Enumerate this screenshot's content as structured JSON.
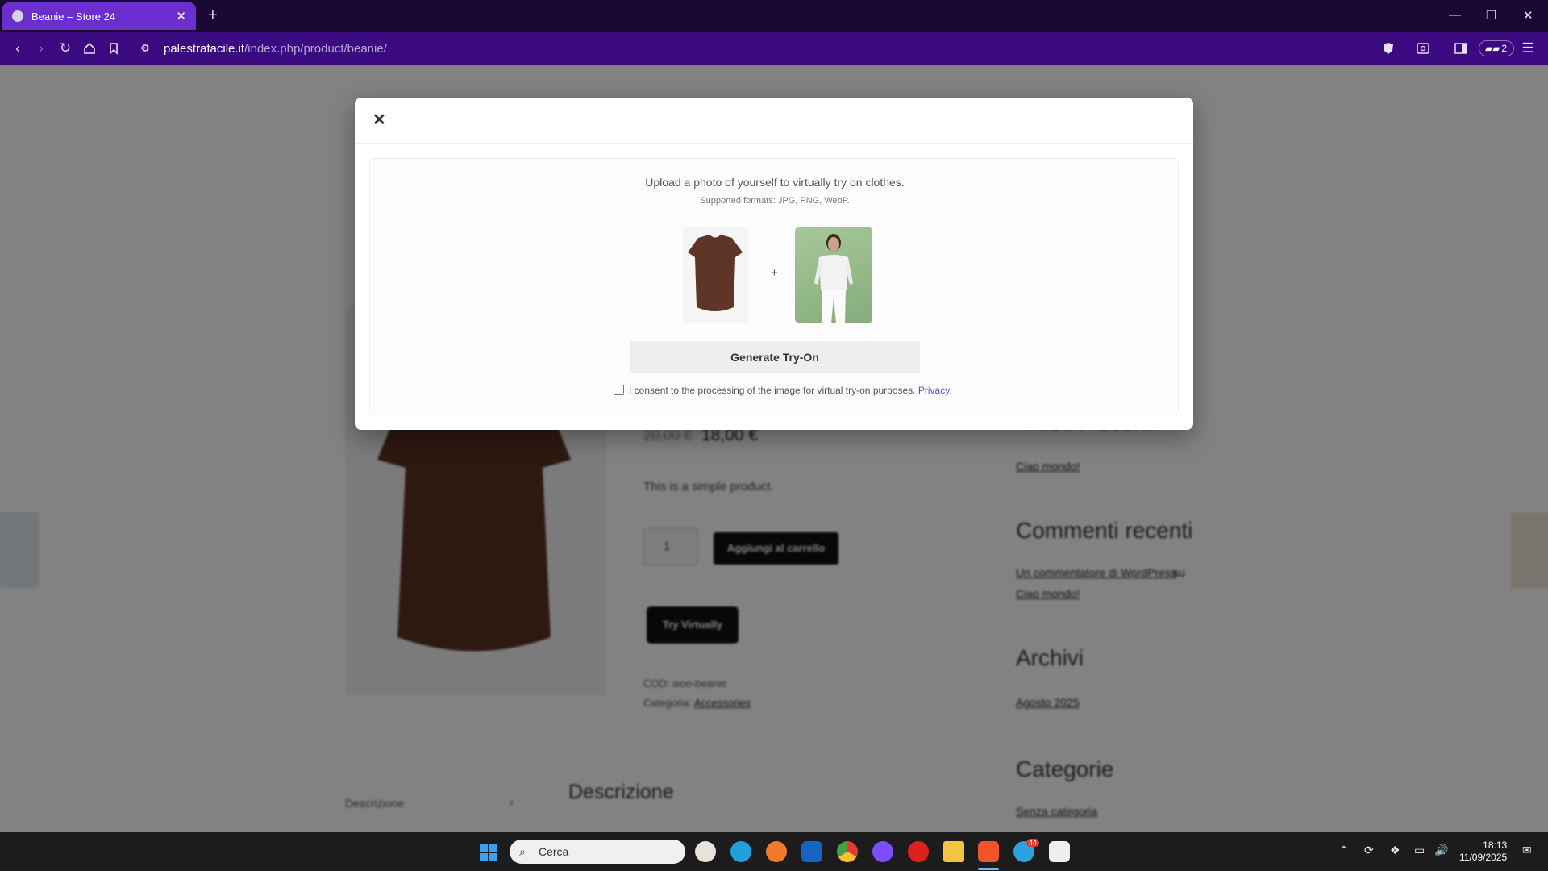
{
  "browser": {
    "tab_title": "Beanie – Store 24",
    "url_domain": "palestrafacile.it",
    "url_path": "/index.php/product/beanie/",
    "rewards_count": "2",
    "accent": "#6c2fcf"
  },
  "page": {
    "price_old": "20,00 €",
    "price_new": "18,00 €",
    "short_desc": "This is a simple product.",
    "qty": "1",
    "add_to_cart": "Aggiungi al carrello",
    "try_virtually": "Try Virtually",
    "sku": "COD: woo-beanie",
    "category_label": "Categoria:",
    "category_link": "Accessories",
    "tab_desc": "Descrizione",
    "desc_heading": "Descrizione",
    "sidebar": {
      "recent_posts_heading": "Articoli recenti",
      "recent_post_1": "Ciao mondo!",
      "recent_comments_heading": "Commenti recenti",
      "comment_author": "Un commentatore di WordPress",
      "comment_sep": "su",
      "comment_post": "Ciao mondo!",
      "archives_heading": "Archivi",
      "archive_1": "Agosto 2025",
      "categories_heading": "Categorie",
      "category_1": "Senza categoria"
    }
  },
  "modal": {
    "title": "Upload a photo of yourself to virtually try on clothes.",
    "subtitle": "Supported formats: JPG, PNG, WebP.",
    "plus": "+",
    "generate_button": "Generate Try-On",
    "consent_text": "I consent to the processing of the image for virtual try-on purposes.",
    "privacy_link": "Privacy."
  },
  "taskbar": {
    "search_placeholder": "Cerca",
    "time": "18:13",
    "date": "11/09/2025",
    "telegram_badge": "44"
  }
}
